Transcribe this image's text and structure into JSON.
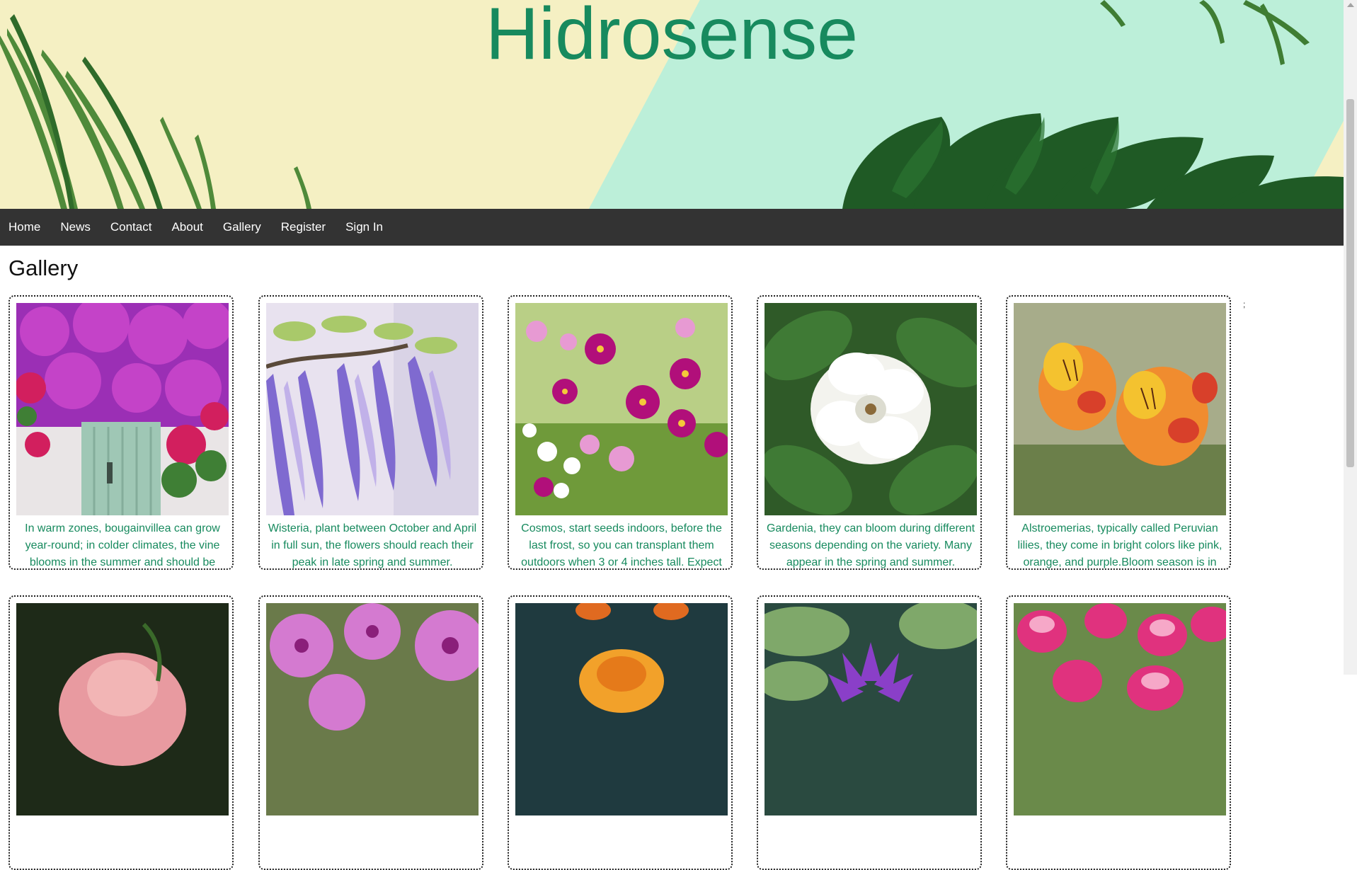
{
  "header": {
    "title": "Hidrosense"
  },
  "nav": {
    "items": [
      {
        "label": "Home"
      },
      {
        "label": "News"
      },
      {
        "label": "Contact"
      },
      {
        "label": "About"
      },
      {
        "label": "Gallery"
      },
      {
        "label": "Register"
      },
      {
        "label": "Sign In"
      }
    ]
  },
  "gallery": {
    "heading": "Gallery",
    "stray_mark": ";",
    "cards": [
      {
        "image": "bougainvillea-photo",
        "caption": "In warm zones, bougainvillea can grow year-round; in colder climates, the vine blooms in the summer and should be brought in for the winter."
      },
      {
        "image": "wisteria-photo",
        "caption": "Wisteria, plant between October and April in full sun, the flowers should reach their peak in late spring and summer."
      },
      {
        "image": "cosmos-photo",
        "caption": "Cosmos, start seeds indoors, before the last frost, so you can transplant them outdoors when 3 or 4 inches tall. Expect flowers in summer and fall."
      },
      {
        "image": "gardenia-photo",
        "caption": "Gardenia, they can bloom during different seasons depending on the variety. Many appear in the spring and summer."
      },
      {
        "image": "alstroemeria-photo",
        "caption": "Alstroemerias, typically called Peruvian lilies, they come in bright colors like pink, orange, and purple.Bloom season is in summer."
      },
      {
        "image": "rose-photo",
        "caption": ""
      },
      {
        "image": "petunia-photo",
        "caption": ""
      },
      {
        "image": "marigold-photo",
        "caption": ""
      },
      {
        "image": "water-lily-photo",
        "caption": ""
      },
      {
        "image": "tulip-photo",
        "caption": ""
      }
    ]
  },
  "colors": {
    "accent": "#178a5e",
    "nav_bg": "#333333"
  }
}
